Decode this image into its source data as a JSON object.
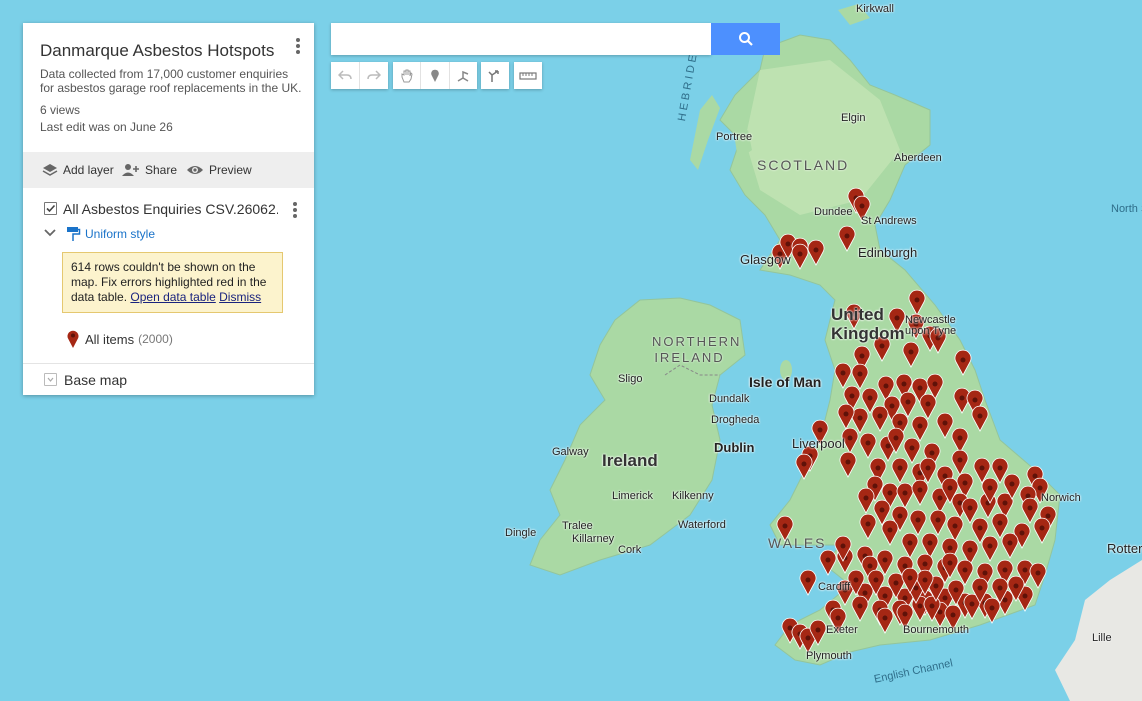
{
  "map": {
    "labels": {
      "kirkwall": "Kirkwall",
      "hebrides": "HEBRIDES",
      "portree": "Portree",
      "elgin": "Elgin",
      "scotland": "SCOTLAND",
      "aberdeen": "Aberdeen",
      "dundee": "Dundee",
      "standrews": "St Andrews",
      "north_sea": "North S",
      "edinburgh": "Edinburgh",
      "glasgow": "Glasgow",
      "united_kingdom": "United Kingdom",
      "newcastle": "Newcastle upon Tyne",
      "northern_ireland": "NORTHERN IRELAND",
      "sligo": "Sligo",
      "isle_of_man": "Isle of Man",
      "dundalk": "Dundalk",
      "drogheda": "Drogheda",
      "dublin": "Dublin",
      "galway": "Galway",
      "ireland": "Ireland",
      "liverpool": "Liverpool",
      "limerick": "Limerick",
      "kilkenny": "Kilkenny",
      "waterford": "Waterford",
      "dingle": "Dingle",
      "tralee": "Tralee",
      "killarney": "Killarney",
      "cork": "Cork",
      "wales": "WALES",
      "norwich": "Norwich",
      "rotterdam": "Rotter",
      "cardiff": "Cardiff",
      "exeter": "Exeter",
      "bournemouth": "Bournemouth",
      "plymouth": "Plymouth",
      "english_channel": "English Channel",
      "lille": "Lille"
    },
    "pin_color": "#a52714"
  },
  "panel": {
    "title": "Danmarque Asbestos Hotspots",
    "description": "Data collected from 17,000 customer enquiries for asbestos garage roof replacements in the UK.",
    "views": "6 views",
    "last_edit": "Last edit was on June 26",
    "toolbar": {
      "add_layer": "Add layer",
      "share": "Share",
      "preview": "Preview"
    },
    "layer": {
      "title": "All Asbestos Enquiries CSV.26062...",
      "style": "Uniform style",
      "error_text": "614 rows couldn't be shown on the map. Fix errors highlighted red in the data table.",
      "open_table": "Open data table",
      "dismiss": "Dismiss",
      "all_items": "All items",
      "all_items_count": "(2000)"
    },
    "base_map": "Base map"
  },
  "search": {
    "value": "",
    "placeholder": ""
  }
}
